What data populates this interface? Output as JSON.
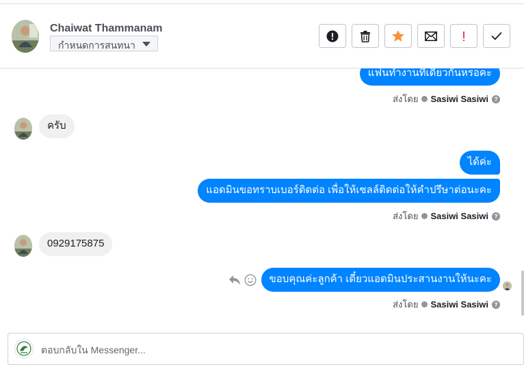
{
  "header": {
    "contact_name": "Chaiwat Thammanam",
    "assign_label": "กำหนดการสนทนา",
    "actions": [
      {
        "name": "spam-button",
        "icon": "exclamation-circle-icon"
      },
      {
        "name": "delete-button",
        "icon": "trash-icon"
      },
      {
        "name": "star-button",
        "icon": "star-icon",
        "color": "#f7923b"
      },
      {
        "name": "mark-unread-button",
        "icon": "envelope-icon"
      },
      {
        "name": "follow-up-button",
        "icon": "exclamation-icon",
        "color": "#e9414f"
      },
      {
        "name": "mark-done-button",
        "icon": "check-icon"
      }
    ]
  },
  "messages": {
    "m1": "แฟนทำงานที่เดียวกันหรอคะ",
    "m2": "ครับ",
    "m3": "ได้ค่ะ",
    "m4": "แอดมินขอทราบเบอร์ติดต่อ เพื่อให้เซลล์ติดต่อให้คำปรึษาต่อนะคะ",
    "m5": "0929175875",
    "m6": "ขอบคุณค่ะลูกค้า เดี๋ยวแอดมินประสานงานให้นะคะ"
  },
  "sent_by": {
    "label": "ส่งโดย",
    "sender": "Sasiwi Sasiwi",
    "help": "?"
  },
  "composer": {
    "placeholder": "ตอบกลับใน Messenger..."
  },
  "colors": {
    "outgoing_bubble": "#0084ff",
    "incoming_bubble": "#f1f0f0",
    "star": "#f7923b",
    "alert": "#e9414f"
  }
}
